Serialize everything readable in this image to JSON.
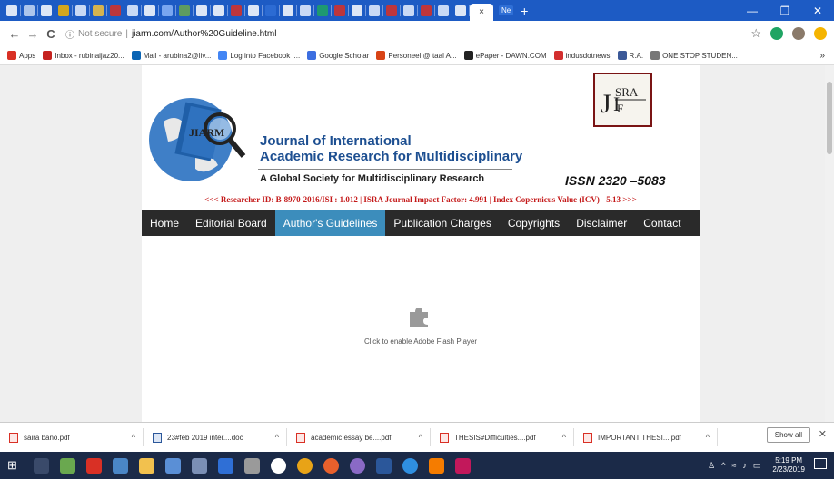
{
  "browser": {
    "active_tab_label": "×",
    "ne_badge": "Ne",
    "new_tab": "+",
    "win_min": "—",
    "win_max": "❐",
    "win_close": "✕",
    "not_secure": "Not secure",
    "url": "jiarm.com/Author%20Guideline.html",
    "back": "←",
    "forward": "→",
    "reload": "C",
    "star": "☆"
  },
  "bookmarks": [
    {
      "label": "Apps",
      "color": "#d93025"
    },
    {
      "label": "Inbox - rubinaijaz20...",
      "color": "#c5221f"
    },
    {
      "label": "Mail - arubina2@liv...",
      "color": "#0a64b4"
    },
    {
      "label": "Log into Facebook |...",
      "color": "#4285f4"
    },
    {
      "label": "Google Scholar",
      "color": "#3c6ee0"
    },
    {
      "label": "Personeel @ taal A...",
      "color": "#d84315"
    },
    {
      "label": "ePaper - DAWN.COM",
      "color": "#222222"
    },
    {
      "label": "indusdotnews",
      "color": "#d32f2f"
    },
    {
      "label": "R.A.",
      "color": "#3b5998"
    },
    {
      "label": "ONE STOP STUDEN...",
      "color": "#777777"
    }
  ],
  "bookmarks_more": "»",
  "site": {
    "title_line1": "Journal of International",
    "title_line2": "Academic Research for Multidisciplinary",
    "subtitle": "A Global Society for Multidisciplinary Research",
    "issn": "ISSN  2320 –5083",
    "logo_text": "JIARM",
    "isra_logo": "ISRA JIF",
    "ticker": "<<< Researcher ID: B-8970-2016/ISI : 1.012 | ISRA Journal Impact Factor: 4.991 | Index Copernicus Value (ICV) - 5.13 >>>"
  },
  "nav": [
    "Home",
    "Editorial Board",
    "Author's Guidelines",
    "Publication Charges",
    "Copyrights",
    "Disclaimer",
    "Contact"
  ],
  "flash_text": "Click to enable Adobe Flash Player",
  "downloads": [
    {
      "name": "saira bano.pdf",
      "type": "pdf"
    },
    {
      "name": "23#feb 2019 inter....doc",
      "type": "doc"
    },
    {
      "name": "academic essay be....pdf",
      "type": "pdf"
    },
    {
      "name": "THESIS#Difficulties....pdf",
      "type": "pdf"
    },
    {
      "name": "IMPORTANT THESI....pdf",
      "type": "pdf"
    }
  ],
  "show_all": "Show all",
  "clock": {
    "time": "5:19 PM",
    "date": "2/23/2019"
  },
  "colors": {
    "chrome_blue": "#1d5bc4",
    "nav_active": "#3c8dbc",
    "nav_bg": "#2a2a2a",
    "ticker_red": "#c41818"
  }
}
